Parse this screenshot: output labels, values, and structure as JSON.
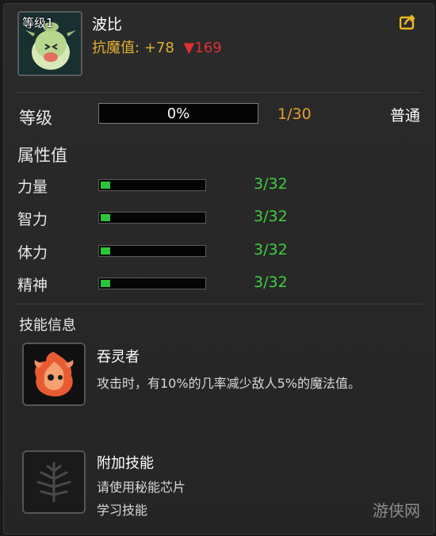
{
  "pet": {
    "level_badge": "等级1",
    "name": "波比",
    "resist_label": "抗魔值:",
    "resist_value": "+78",
    "resist_down": "▼169"
  },
  "level": {
    "label": "等级",
    "progress_text": "0%",
    "progress_fraction": 0,
    "count": "1/30",
    "rarity": "普通"
  },
  "attributes": {
    "title": "属性值",
    "items": [
      {
        "label": "力量",
        "value": "3/32",
        "fraction": 0.094
      },
      {
        "label": "智力",
        "value": "3/32",
        "fraction": 0.094
      },
      {
        "label": "体力",
        "value": "3/32",
        "fraction": 0.094
      },
      {
        "label": "精神",
        "value": "3/32",
        "fraction": 0.094
      }
    ]
  },
  "skills": {
    "title": "技能信息",
    "primary": {
      "name": "吞灵者",
      "description": "攻击时，有10%的几率减少敌人5%的魔法值。"
    },
    "extra": {
      "name": "附加技能",
      "line1": "请使用秘能芯片",
      "line2": "学习技能"
    }
  },
  "watermark": "游侠网",
  "icons": {
    "share": "share-icon",
    "pet": "pet-portrait",
    "fire_skill": "fire-spirit-icon",
    "locked_skill": "locked-skill-icon"
  },
  "colors": {
    "resist": "#e0b030",
    "down": "#e03030",
    "stat_value": "#3fcf3f",
    "level_count": "#e0a030"
  }
}
